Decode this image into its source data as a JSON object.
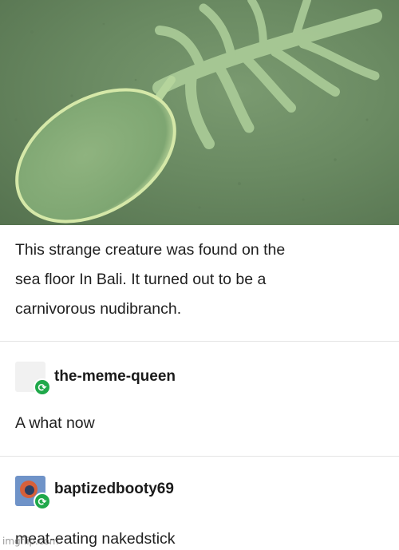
{
  "photo": {
    "colors": {
      "sand": "#6a8a62",
      "creature": "#9bc08a"
    }
  },
  "post": {
    "caption_lines": [
      "This strange creature was found on the",
      "sea floor In Bali. It turned out to be a",
      "carnivorous nudibranch."
    ]
  },
  "reblogs": [
    {
      "username": "the-meme-queen",
      "comment": "A what now",
      "avatar": "blank-avatar"
    },
    {
      "username": "baptizedbooty69",
      "comment": "meat-eating nakedstick",
      "avatar": "orange-circle-avatar"
    }
  ],
  "reblog_icon_glyph": "⟳",
  "watermark": "imgflip.com",
  "colors": {
    "reblog_green": "#1fa84a",
    "divider": "#e4e4e4"
  }
}
